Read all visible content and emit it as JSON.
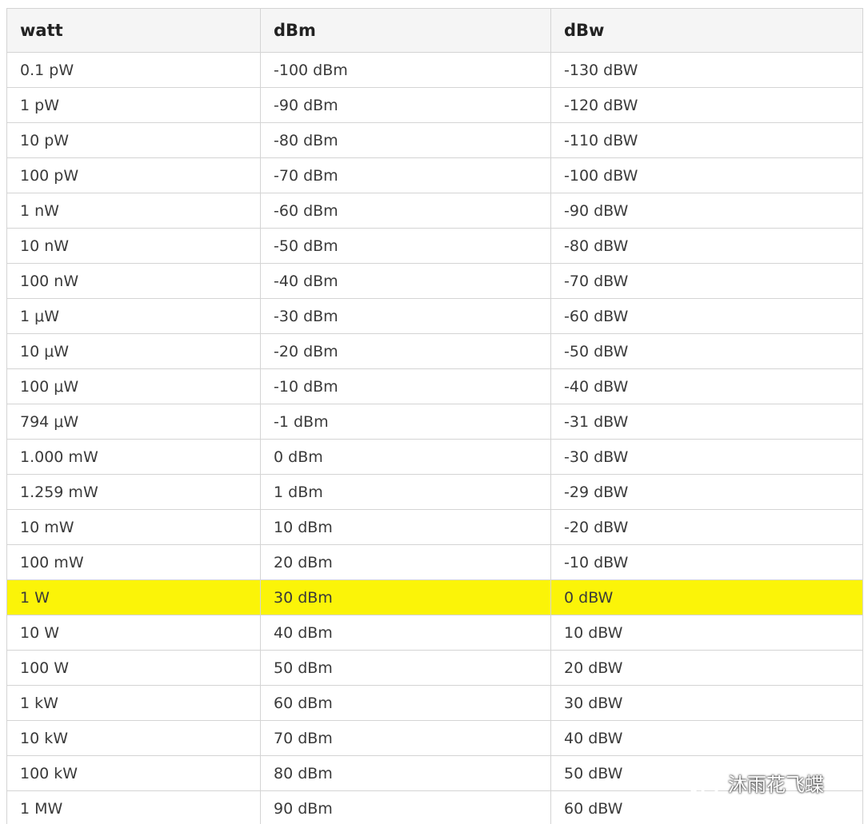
{
  "table": {
    "headers": [
      "watt",
      "dBm",
      "dBw"
    ],
    "rows": [
      [
        "0.1 pW",
        "-100 dBm",
        "-130 dBW"
      ],
      [
        "1 pW",
        "-90 dBm",
        "-120 dBW"
      ],
      [
        "10 pW",
        "-80 dBm",
        "-110 dBW"
      ],
      [
        "100 pW",
        "-70 dBm",
        "-100 dBW"
      ],
      [
        "1 nW",
        "-60 dBm",
        "-90 dBW"
      ],
      [
        "10 nW",
        "-50 dBm",
        "-80 dBW"
      ],
      [
        "100 nW",
        "-40 dBm",
        "-70 dBW"
      ],
      [
        "1 μW",
        "-30 dBm",
        "-60 dBW"
      ],
      [
        "10 μW",
        "-20 dBm",
        "-50 dBW"
      ],
      [
        "100 μW",
        "-10 dBm",
        "-40 dBW"
      ],
      [
        "794 μW",
        "-1 dBm",
        "-31 dBW"
      ],
      [
        "1.000 mW",
        "0 dBm",
        "-30 dBW"
      ],
      [
        "1.259 mW",
        "1 dBm",
        "-29 dBW"
      ],
      [
        "10 mW",
        "10 dBm",
        "-20 dBW"
      ],
      [
        "100 mW",
        "20 dBm",
        "-10 dBW"
      ],
      [
        "1 W",
        "30 dBm",
        "0 dBW"
      ],
      [
        "10 W",
        "40 dBm",
        "10 dBW"
      ],
      [
        "100 W",
        "50 dBm",
        "20 dBW"
      ],
      [
        "1 kW",
        "60 dBm",
        "30 dBW"
      ],
      [
        "10 kW",
        "70 dBm",
        "40 dBW"
      ],
      [
        "100 kW",
        "80 dBm",
        "50 dBW"
      ],
      [
        "1 MW",
        "90 dBm",
        "60 dBW"
      ]
    ],
    "highlighted_row_index": 15,
    "highlight_color": "#fbf408"
  },
  "watermark": {
    "text": "沐雨花飞蝶",
    "icon": "wechat-icon"
  }
}
